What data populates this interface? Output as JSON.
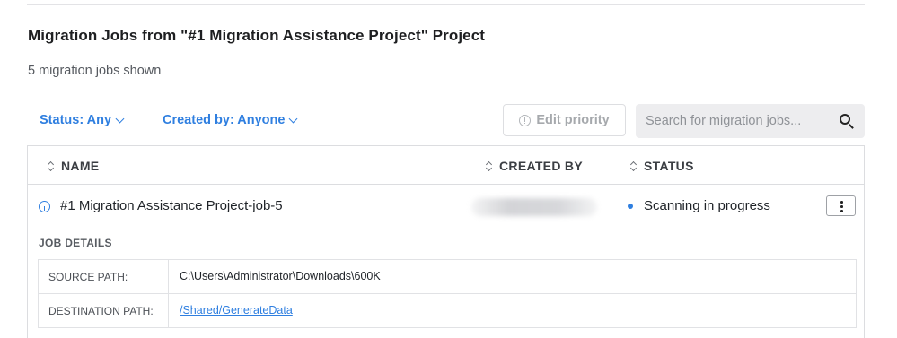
{
  "page": {
    "title": "Migration Jobs from \"#1 Migration Assistance Project\" Project",
    "subtitle": "5 migration jobs shown"
  },
  "filters": {
    "status_label": "Status: Any",
    "created_by_label": "Created by: Anyone"
  },
  "toolbar": {
    "edit_priority_label": "Edit priority",
    "edit_priority_enabled": false,
    "search_placeholder": "Search for migration jobs..."
  },
  "table": {
    "headers": {
      "name": "NAME",
      "created_by": "CREATED BY",
      "status": "STATUS"
    },
    "rows": [
      {
        "name": "#1 Migration Assistance Project-job-5",
        "created_by_redacted": true,
        "status": "Scanning in progress",
        "status_color": "#2f7fe0",
        "details": {
          "label": "JOB DETAILS",
          "source_path_label": "SOURCE PATH:",
          "source_path": "C:\\Users\\Administrator\\Downloads\\600K",
          "destination_path_label": "DESTINATION PATH:",
          "destination_path": "/Shared/GenerateData"
        }
      }
    ]
  },
  "colors": {
    "accent": "#2f7fe0",
    "text": "#1f2328",
    "muted": "#55595f"
  },
  "icons": [
    "chevron-down-icon",
    "info-circle-icon",
    "search-icon",
    "sort-icon",
    "kebab-menu-icon"
  ]
}
